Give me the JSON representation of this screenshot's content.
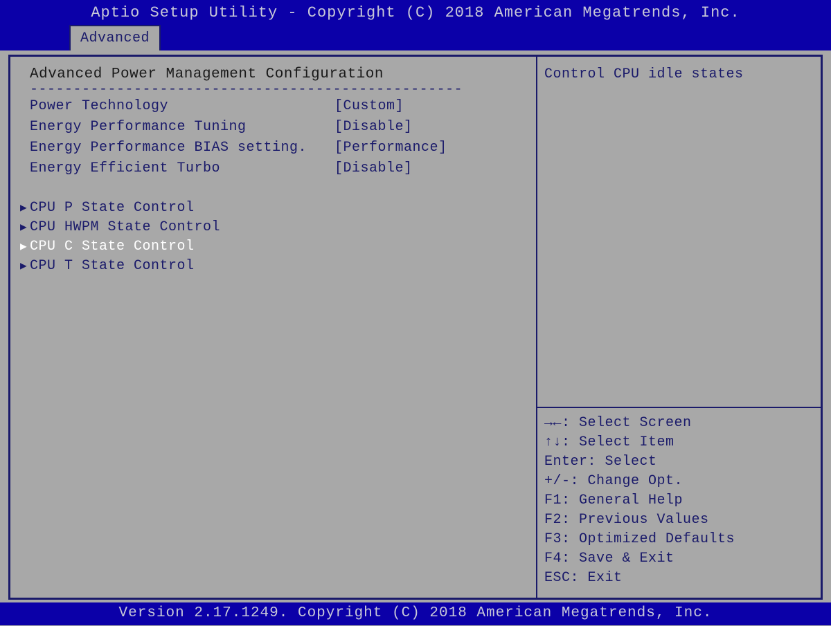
{
  "titlebar": "Aptio Setup Utility - Copyright (C) 2018 American Megatrends, Inc.",
  "tab": {
    "label": "Advanced"
  },
  "section": {
    "title": "Advanced Power Management Configuration",
    "dashes": "--------------------------------------------------"
  },
  "settings": [
    {
      "label": "Power Technology",
      "value": "[Custom]"
    },
    {
      "label": "Energy Performance Tuning",
      "value": "[Disable]"
    },
    {
      "label": "Energy Performance BIAS setting.",
      "value": "[Performance]"
    },
    {
      "label": "Energy Efficient Turbo",
      "value": "[Disable]"
    }
  ],
  "submenus": [
    {
      "label": "CPU P State Control",
      "selected": false
    },
    {
      "label": "CPU HWPM State Control",
      "selected": false
    },
    {
      "label": "CPU C State Control",
      "selected": true
    },
    {
      "label": "CPU T State Control",
      "selected": false
    }
  ],
  "help": "Control CPU idle states",
  "keyhelp": [
    "→←: Select Screen",
    "↑↓: Select Item",
    "Enter: Select",
    "+/-: Change Opt.",
    "F1: General Help",
    "F2: Previous Values",
    "F3: Optimized Defaults",
    "F4: Save & Exit",
    "ESC: Exit"
  ],
  "footer": "Version 2.17.1249. Copyright (C) 2018 American Megatrends, Inc."
}
